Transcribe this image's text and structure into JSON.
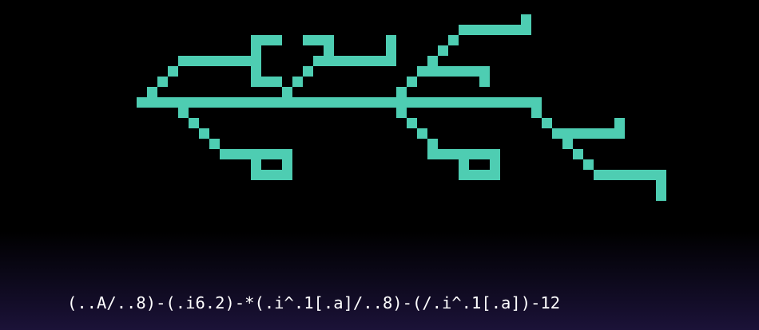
{
  "code": {
    "text": "(..A/..8)-(.i6.2)-*(.i^.1[.a]/..8)-(/.i^.1[.a])-12",
    "color": "#ffffff"
  },
  "pixel_art": {
    "color": "#4ecdb2",
    "background": "#000000"
  }
}
